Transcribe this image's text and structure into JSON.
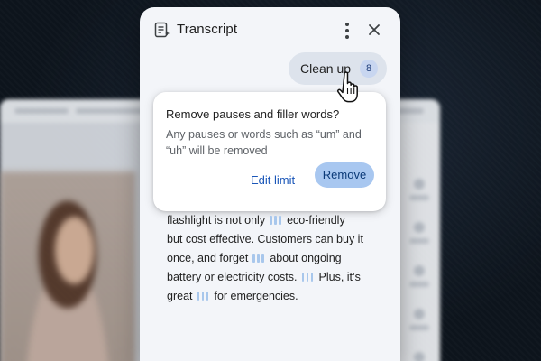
{
  "panel": {
    "title": "Transcript",
    "icons": {
      "header": "transcript-icon",
      "more": "more-vert-icon",
      "close": "close-icon",
      "cursor": "hand-pointer-icon",
      "pause_marker": "pause-marker-icon"
    }
  },
  "cleanup": {
    "label": "Clean up",
    "count": "8"
  },
  "popup": {
    "title": "Remove pauses and filler words?",
    "body": "Any pauses or words such as “um” and “uh” will be removed",
    "edit_label": "Edit limit",
    "remove_label": "Remove"
  },
  "transcript": {
    "segments": [
      "flashlight is not only",
      "eco-friendly",
      "but cost effective. Customers can buy it",
      "once, and forget",
      "about ongoing",
      "battery or electricity costs.",
      "Plus, it’s",
      "great",
      "for emergencies."
    ]
  },
  "colors": {
    "accent": "#a8c7f0",
    "link": "#1a56b8",
    "panel_bg": "#f3f5f9",
    "pause_marker": "#a8c7ec"
  }
}
